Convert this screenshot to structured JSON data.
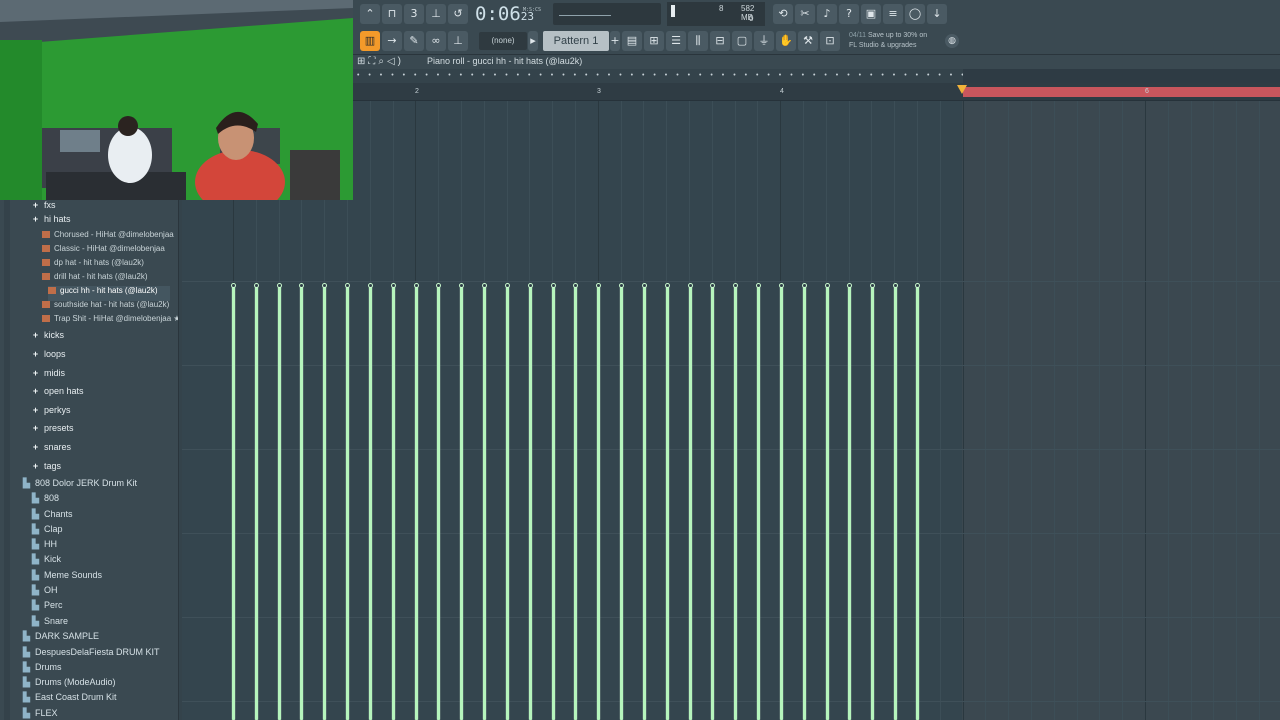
{
  "toolbar": {
    "time_main": "0:06",
    "time_sub": "23",
    "time_unit": "M:S:CS",
    "cpu_value": "8",
    "memory": "582 MB",
    "polyphony": "0",
    "channel_filter": "(none)",
    "pattern": "Pattern 1",
    "news_date": "04/11",
    "news_line1": "Save up to 30% on",
    "news_line2": "FL Studio & upgrades"
  },
  "piano_roll": {
    "title": "Piano roll - gucci hh - hit hats (@lau2k)",
    "bar_numbers": [
      "2",
      "3",
      "4",
      "6"
    ]
  },
  "browser": {
    "items": [
      {
        "label": "fxs",
        "kind": "group"
      },
      {
        "label": "hi hats",
        "kind": "group"
      },
      {
        "label": "Chorused - HiHat @dimelobenjaa",
        "kind": "file"
      },
      {
        "label": "Classic - HiHat @dimelobenjaa",
        "kind": "file"
      },
      {
        "label": "dp hat - hit hats (@lau2k)",
        "kind": "file"
      },
      {
        "label": "drill hat - hit hats (@lau2k)",
        "kind": "file"
      },
      {
        "label": "gucci hh - hit hats (@lau2k)",
        "kind": "file-selected"
      },
      {
        "label": "southside hat - hit hats (@lau2k)",
        "kind": "file"
      },
      {
        "label": "Trap Shit - HiHat @dimelobenjaa ★",
        "kind": "file"
      },
      {
        "label": "kicks",
        "kind": "group"
      },
      {
        "label": "loops",
        "kind": "group"
      },
      {
        "label": "midis",
        "kind": "group"
      },
      {
        "label": "open hats",
        "kind": "group"
      },
      {
        "label": "perkys",
        "kind": "group"
      },
      {
        "label": "presets",
        "kind": "group"
      },
      {
        "label": "snares",
        "kind": "group"
      },
      {
        "label": "tags",
        "kind": "group"
      },
      {
        "label": "808 Dolor JERK Drum Kit",
        "kind": "folder-root"
      },
      {
        "label": "808",
        "kind": "folder"
      },
      {
        "label": "Chants",
        "kind": "folder"
      },
      {
        "label": "Clap",
        "kind": "folder"
      },
      {
        "label": "HH",
        "kind": "folder"
      },
      {
        "label": "Kick",
        "kind": "folder"
      },
      {
        "label": "Meme Sounds",
        "kind": "folder"
      },
      {
        "label": "OH",
        "kind": "folder"
      },
      {
        "label": "Perc",
        "kind": "folder"
      },
      {
        "label": "Snare",
        "kind": "folder"
      },
      {
        "label": "DARK SAMPLE",
        "kind": "folder-root"
      },
      {
        "label": "DespuesDelaFiesta DRUM KIT",
        "kind": "folder-root"
      },
      {
        "label": "Drums",
        "kind": "folder-root"
      },
      {
        "label": "Drums (ModeAudio)",
        "kind": "folder-root"
      },
      {
        "label": "East Coast Drum Kit",
        "kind": "folder-root"
      },
      {
        "label": "FLEX",
        "kind": "folder-root"
      }
    ]
  },
  "notes": {
    "count": 31,
    "color": "#b6f5bd"
  },
  "colors": {
    "accent": "#f39a2a",
    "loop_region": "#c9565d",
    "playhead": "#f0b23a"
  }
}
